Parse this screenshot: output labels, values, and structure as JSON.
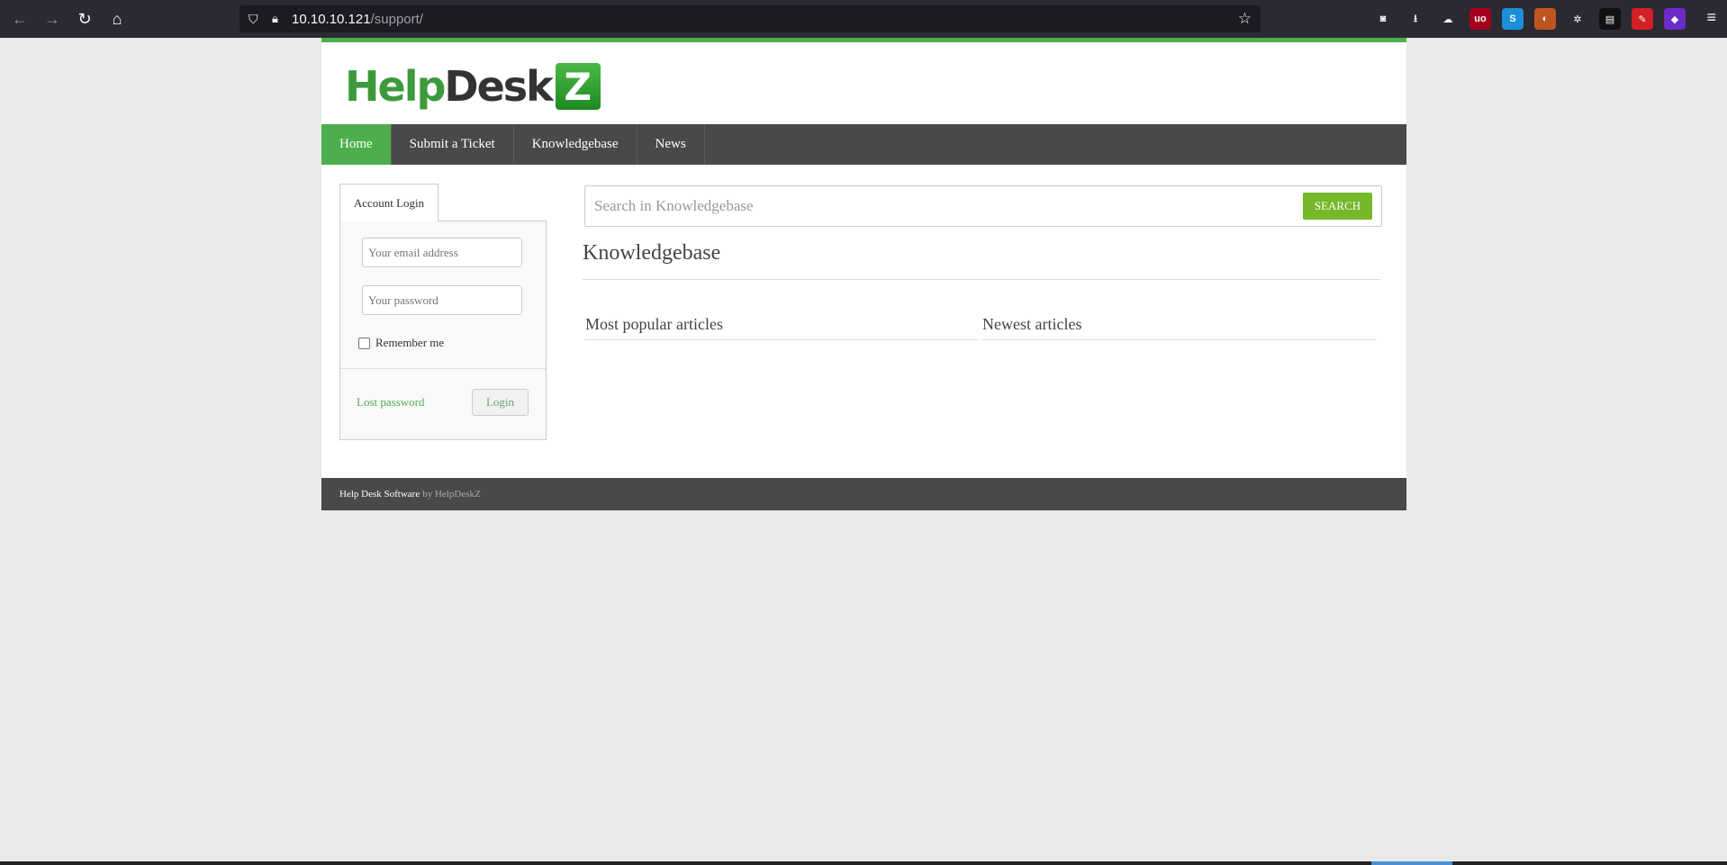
{
  "browser": {
    "url_host": "10.10.10.121",
    "url_path": "/support/",
    "extensions": [
      {
        "name": "pocket-icon",
        "glyph": "◙",
        "color": "#2b2a33"
      },
      {
        "name": "download-icon",
        "glyph": "⭳",
        "color": "#2b2a33"
      },
      {
        "name": "cloud-icon",
        "glyph": "☁",
        "color": "#2b2a33"
      },
      {
        "name": "ublock-icon",
        "glyph": "uo",
        "color": "#a4001f"
      },
      {
        "name": "s-extension-icon",
        "glyph": "S",
        "color": "#1b8fd8"
      },
      {
        "name": "cookie-icon",
        "glyph": "◐",
        "color": "#c0541f"
      },
      {
        "name": "settings-extension-icon",
        "glyph": "✲",
        "color": "#2b2a33"
      },
      {
        "name": "terminal-icon",
        "glyph": "▤",
        "color": "#111"
      },
      {
        "name": "pen-icon",
        "glyph": "✎",
        "color": "#d32027"
      },
      {
        "name": "gem-icon",
        "glyph": "◆",
        "color": "#6b2bc8"
      }
    ]
  },
  "brand": {
    "logo_help": "Help",
    "logo_desk": "Desk",
    "logo_z": "Z",
    "accent_color": "#4cae4c"
  },
  "nav": {
    "items": [
      {
        "label": "Home",
        "active": true
      },
      {
        "label": "Submit a Ticket",
        "active": false
      },
      {
        "label": "Knowledgebase",
        "active": false
      },
      {
        "label": "News",
        "active": false
      }
    ]
  },
  "login": {
    "tab_label": "Account Login",
    "email_placeholder": "Your email address",
    "password_placeholder": "Your password",
    "remember_label": "Remember me",
    "lost_password_label": "Lost password",
    "login_button_label": "Login"
  },
  "search": {
    "placeholder": "Search in Knowledgebase",
    "button_label": "SEARCH"
  },
  "knowledgebase": {
    "title": "Knowledgebase",
    "popular_title": "Most popular articles",
    "newest_title": "Newest articles"
  },
  "footer": {
    "software": "Help Desk Software",
    "by": "by HelpDeskZ"
  }
}
